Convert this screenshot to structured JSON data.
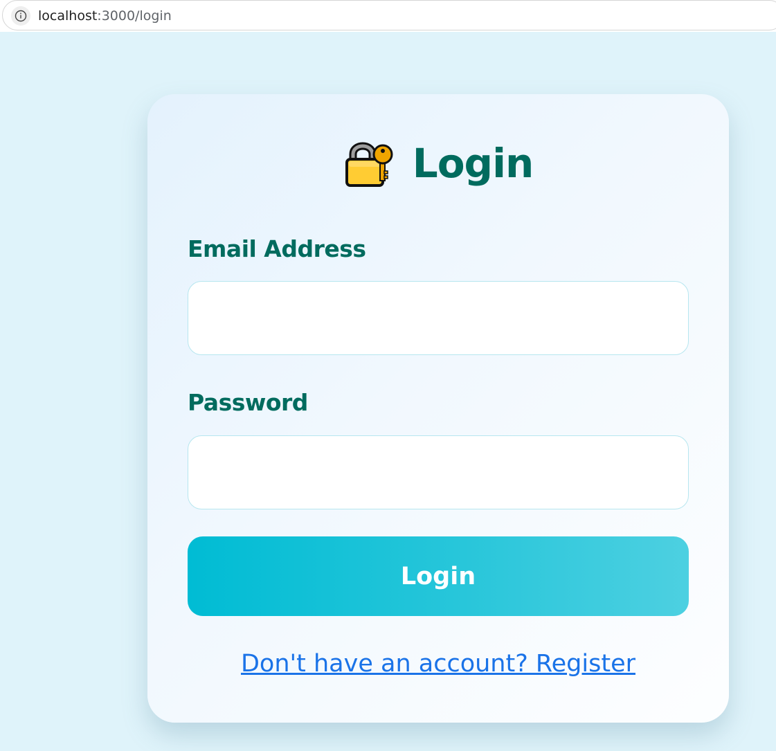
{
  "browser": {
    "url_host": "localhost",
    "url_path": ":3000/login",
    "info_icon": "info-icon"
  },
  "login_form": {
    "title": "Login",
    "title_icon": "locked-with-key-icon",
    "email_label": "Email Address",
    "email_value": "",
    "password_label": "Password",
    "password_value": "",
    "submit_label": "Login",
    "register_link": "Don't have an account? Register"
  },
  "colors": {
    "page_background": "#dff3fa",
    "heading": "#006b5e",
    "button_start": "#00bcd4",
    "button_end": "#4dd0e1",
    "link": "#1a73e8"
  }
}
